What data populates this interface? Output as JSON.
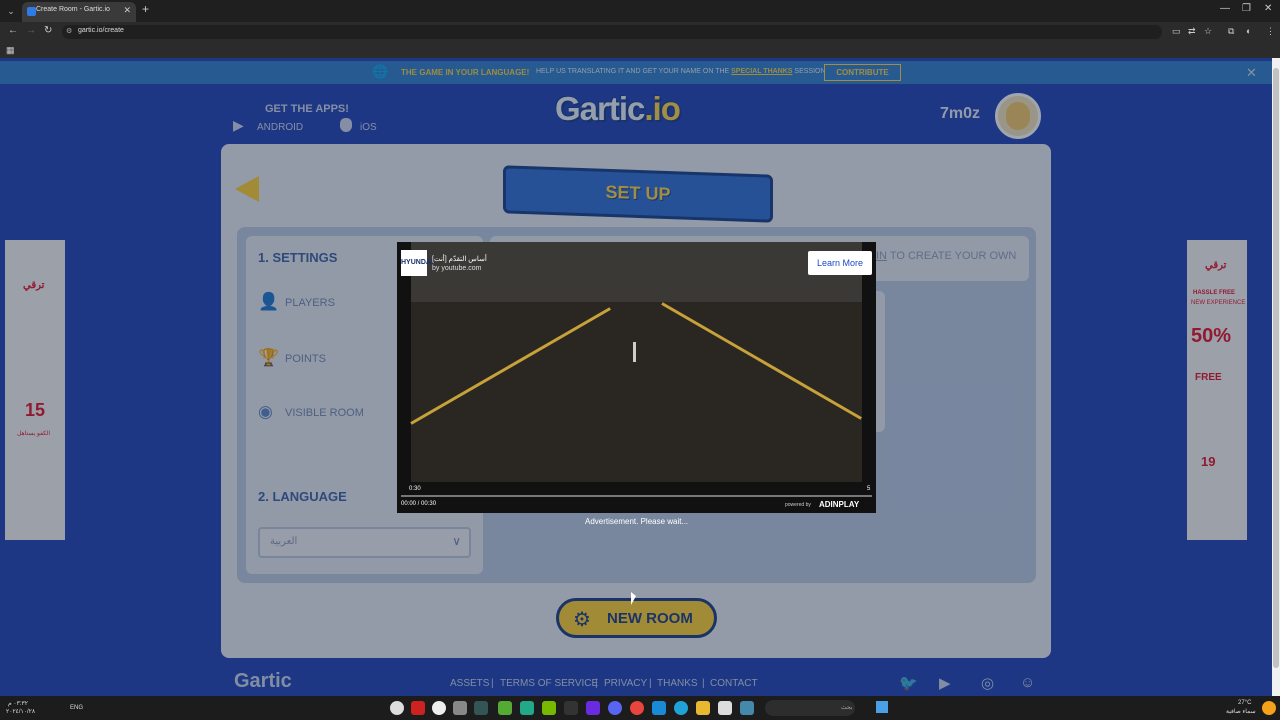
{
  "browser": {
    "tab_title": "Create Room - Gartic.io",
    "url": "gartic.io/create",
    "window_controls": [
      "—",
      "❐",
      "✕"
    ]
  },
  "banner": {
    "bold_text": "THE GAME IN YOUR LANGUAGE!",
    "text_before_link": "HELP US TRANSLATING IT AND GET YOUR NAME ON THE ",
    "link_text": "SPECIAL THANKS",
    "text_after_link": " SESSION",
    "button_label": "CONTRIBUTE",
    "close": "✕"
  },
  "header": {
    "get_apps": "GET THE APPS!",
    "android": "ANDROID",
    "ios": "iOS",
    "logo_main": "Gartic",
    "logo_suffix": ".io",
    "username": "7m0z"
  },
  "setup": {
    "title": "SET UP",
    "settings_title": "1. SETTINGS",
    "items": [
      "PLAYERS",
      "POINTS",
      "VISIBLE ROOM"
    ],
    "language_title": "2. LANGUAGE",
    "language_value": "العربية",
    "login_hint_link": "IN",
    "login_hint_text": " TO CREATE YOUR OWN",
    "new_room": "NEW ROOM"
  },
  "footer": {
    "logo": "Gartic",
    "links": [
      "ASSETS",
      "TERMS OF SERVICE",
      "PRIVACY",
      "THANKS",
      "CONTACT"
    ]
  },
  "video_ad": {
    "channel_badge": "HYUNDAI",
    "title": "[أنت] أساس التقدّم",
    "source": "by youtube.com",
    "learn_more": "Learn More",
    "counter": "0:30",
    "time": "00:00 / 00:30",
    "powered_by": "powered by",
    "brand": "ADINPLAY",
    "wait_text": "Advertisement. Please wait...",
    "remaining": "5",
    "progress_fraction": 0
  },
  "side_ads": {
    "left_top": "ترقي",
    "left_number": "15",
    "left_bottom": "الكفو يستاهل",
    "right_top": "ترقي",
    "right_headline": "HASSLE FREE",
    "right_sub": "NEW EXPERIENCE",
    "right_percent": "50%",
    "right_free": "FREE",
    "right_price": "19"
  },
  "taskbar": {
    "lang": "ENG",
    "search_placeholder": "بحث",
    "weather": "27°C",
    "weather_desc": "سماء صافية",
    "time": "٠٣:٣٢ م",
    "date": "٢٠٢٤/١٠/٢٨"
  },
  "colors": {
    "page_bg": "#1d43b8",
    "accent": "#ffd233",
    "ad_red": "#e4102b"
  }
}
